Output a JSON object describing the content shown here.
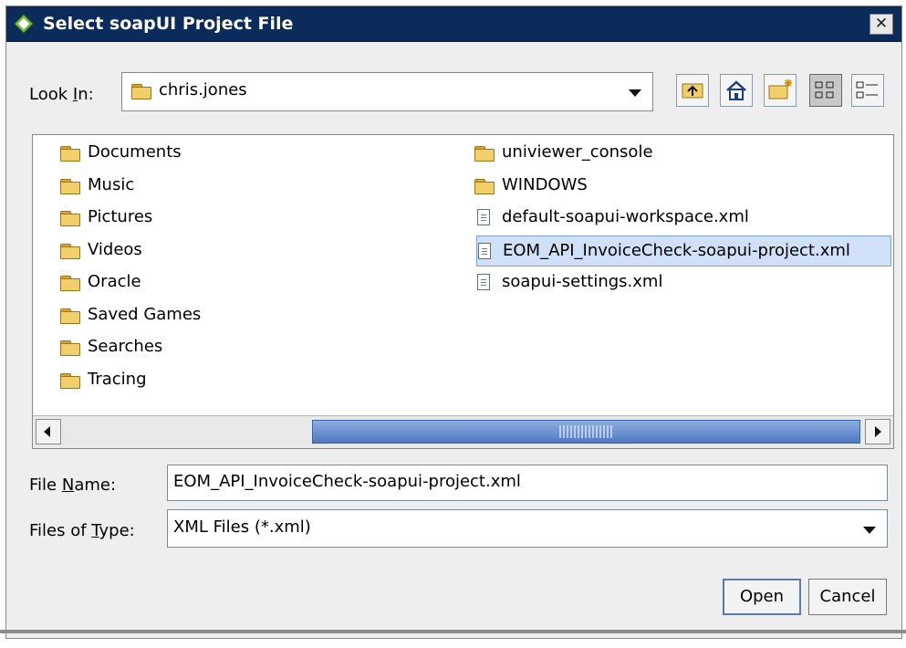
{
  "dialog": {
    "title": "Select soapUI Project File",
    "close_glyph": "✕"
  },
  "look_in": {
    "label_pre": "Look ",
    "label_mnemonic": "I",
    "label_post": "n:",
    "value": "chris.jones",
    "icon": "folder-icon"
  },
  "toolbar": {
    "buttons": [
      {
        "name": "up-one-level-icon"
      },
      {
        "name": "home-icon"
      },
      {
        "name": "create-new-folder-icon"
      },
      {
        "name": "list-view-icon",
        "pressed": true
      },
      {
        "name": "details-view-icon"
      }
    ]
  },
  "files": {
    "left_column": [
      {
        "name": "Documents",
        "type": "folder"
      },
      {
        "name": "Music",
        "type": "folder"
      },
      {
        "name": "Pictures",
        "type": "folder"
      },
      {
        "name": "Videos",
        "type": "folder"
      },
      {
        "name": "Oracle",
        "type": "folder"
      },
      {
        "name": "Saved Games",
        "type": "folder"
      },
      {
        "name": "Searches",
        "type": "folder"
      },
      {
        "name": "Tracing",
        "type": "folder"
      }
    ],
    "right_column": [
      {
        "name": "univiewer_console",
        "type": "folder"
      },
      {
        "name": "WINDOWS",
        "type": "folder"
      },
      {
        "name": "default-soapui-workspace.xml",
        "type": "file"
      },
      {
        "name": "EOM_API_InvoiceCheck-soapui-project.xml",
        "type": "file",
        "selected": true
      },
      {
        "name": "soapui-settings.xml",
        "type": "file"
      }
    ]
  },
  "file_name": {
    "label_pre": "File ",
    "label_mnemonic": "N",
    "label_post": "ame:",
    "value": "EOM_API_InvoiceCheck-soapui-project.xml"
  },
  "file_type": {
    "label_pre": "Files of ",
    "label_mnemonic": "T",
    "label_post": "ype:",
    "value": "XML Files (*.xml)"
  },
  "buttons": {
    "open": "Open",
    "cancel": "Cancel"
  },
  "colors": {
    "titlebar": "#0b2b5b",
    "selection": "#cfe0f7",
    "scroll_thumb": "#4f79c4"
  }
}
